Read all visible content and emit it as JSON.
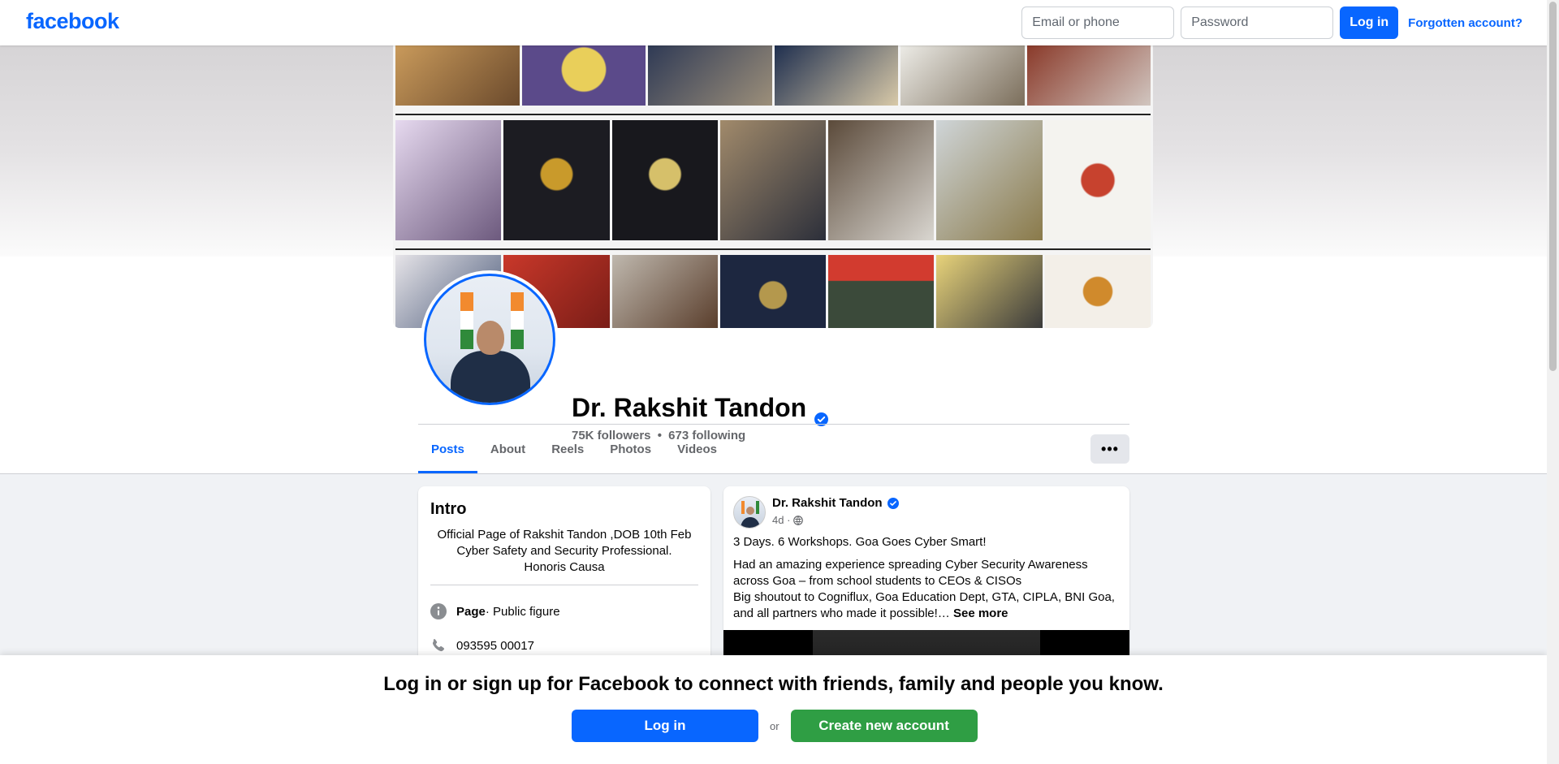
{
  "topbar": {
    "logo": "facebook",
    "email_placeholder": "Email or phone",
    "password_placeholder": "Password",
    "login_label": "Log in",
    "forgot_label": "Forgotten account?"
  },
  "profile": {
    "name": "Dr. Rakshit Tandon",
    "followers": "75K followers",
    "separator": "•",
    "following": "673 following"
  },
  "tabs": [
    "Posts",
    "About",
    "Reels",
    "Photos",
    "Videos"
  ],
  "more_label": "•••",
  "intro": {
    "title": "Intro",
    "bio_lines": [
      "Official Page of Rakshit Tandon ,DOB 10th Feb",
      "Cyber Safety and Security Professional.",
      "Honoris Causa"
    ],
    "category_label": "Page",
    "category_value": " · Public figure",
    "phone": "093595 00017"
  },
  "post": {
    "author": "Dr. Rakshit Tandon",
    "time": "4d ·",
    "headline": "3 Days. 6 Workshops. Goa Goes Cyber Smart!",
    "body_lines": [
      "Had an amazing experience spreading Cyber Security Awareness",
      "across Goa – from school students to CEOs & CISOs",
      "Big shoutout to Cogniflux, Goa Education Dept, GTA, CIPLA, BNI Goa,",
      "and all partners who made it possible!…"
    ],
    "see_more": "See more"
  },
  "banner": {
    "text": "Log in or sign up for Facebook to connect with friends, family and people you know.",
    "login_label": "Log in",
    "or_label": "or",
    "create_label": "Create new account"
  },
  "colors": {
    "brand_blue": "#0866ff",
    "create_green": "#2f9e44",
    "text_secondary": "#65676b"
  },
  "icons": {
    "verified": "verified-badge-icon",
    "info": "info-icon",
    "phone": "phone-icon",
    "globe": "globe-icon"
  }
}
